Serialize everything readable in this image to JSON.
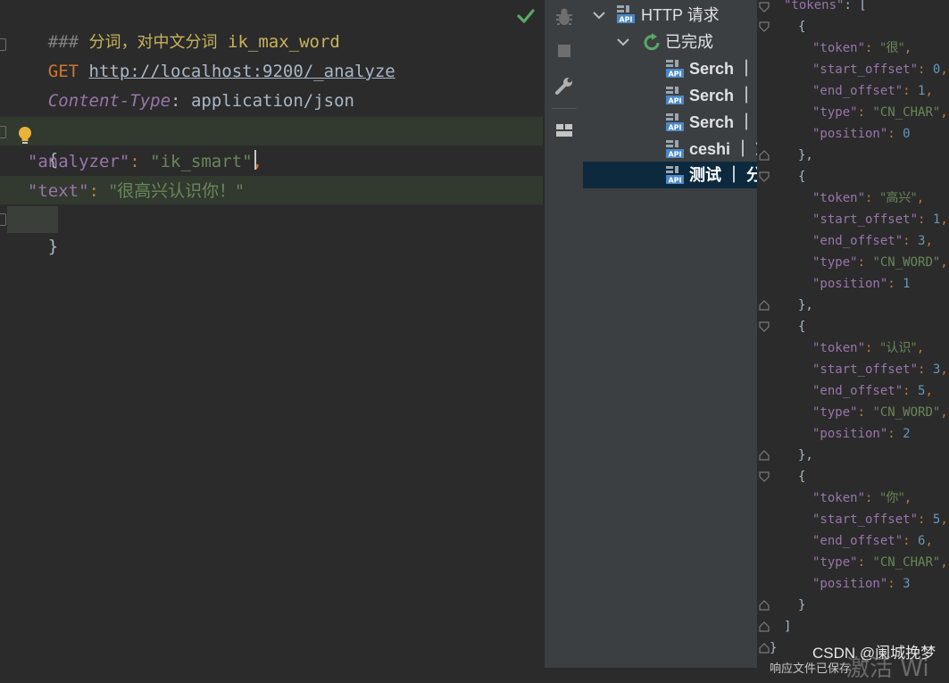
{
  "editor": {
    "comment_prefix": "###",
    "comment_cn": "分词，对中文分词",
    "comment_word": "ik_max_word",
    "method": "GET",
    "url": "http://localhost:9200/_analyze",
    "header_name": "Content-Type",
    "header_colon": ":",
    "header_value": "application/json",
    "brace_open": "{",
    "analyzer_key": "\"analyzer\"",
    "analyzer_value": "\"ik_smart\"",
    "text_key": "\"text\"",
    "text_value": "\"很高兴认识你！\"",
    "colon": ": ",
    "comma": ",",
    "brace_close": "}"
  },
  "tree": {
    "root_label": "HTTP 请求",
    "group_label": "已完成",
    "items": [
      {
        "label": "Serch ｜"
      },
      {
        "label": "Serch ｜"
      },
      {
        "label": "Serch ｜"
      },
      {
        "label": "ceshi ｜ 东"
      },
      {
        "label": "测试 ｜ 分"
      }
    ]
  },
  "response": {
    "tokens_key": "\"tokens\"",
    "tokens_open": ": [",
    "items": [
      {
        "token": "\"很\"",
        "start_offset": "0",
        "end_offset": "1",
        "type": "\"CN_CHAR\"",
        "position": "0"
      },
      {
        "token": "\"高兴\"",
        "start_offset": "1",
        "end_offset": "3",
        "type": "\"CN_WORD\"",
        "position": "1"
      },
      {
        "token": "\"认识\"",
        "start_offset": "3",
        "end_offset": "5",
        "type": "\"CN_WORD\"",
        "position": "2"
      },
      {
        "token": "\"你\"",
        "start_offset": "5",
        "end_offset": "6",
        "type": "\"CN_CHAR\"",
        "position": "3"
      }
    ],
    "k_token": "\"token\"",
    "k_start": "\"start_offset\"",
    "k_end": "\"end_offset\"",
    "k_type": "\"type\"",
    "k_position": "\"position\"",
    "obj_open": "{",
    "obj_close": "},",
    "obj_close_last": "}",
    "arr_close": "]",
    "root_close": "}",
    "footer_cut": "响应文件已保存",
    "activate_cut": "激活 Wi"
  },
  "watermark": "CSDN @阑城挽梦",
  "colors": {
    "editor_bg": "#2b2b2b",
    "panel_bg": "#3c3f41",
    "selected_row": "#0d293e",
    "keyword": "#cc7832",
    "string": "#6a8759",
    "json_key": "#9876aa",
    "number": "#6897bb",
    "success": "#59a869"
  },
  "icons": {
    "check": "check-icon",
    "bulb": "lightbulb-icon",
    "debug": "bug-icon",
    "stop": "stop-icon",
    "settings": "wrench-icon",
    "layout": "layout-icon",
    "api": "api-icon",
    "rerun": "rerun-icon"
  }
}
